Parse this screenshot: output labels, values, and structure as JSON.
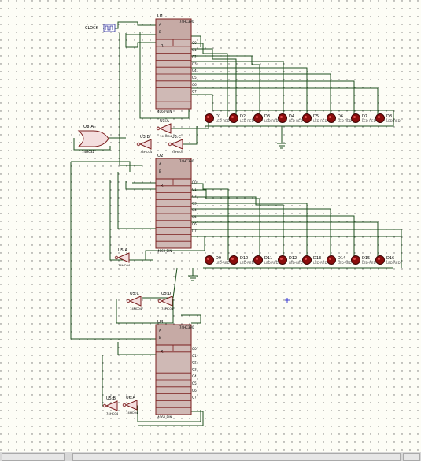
{
  "clock": {
    "label": "CLOCK"
  },
  "counters": [
    {
      "ref": "U1",
      "part": "74HC390"
    },
    {
      "ref": "U2",
      "part": "74HC390"
    },
    {
      "ref": "U4",
      "part": "74HC390"
    }
  ],
  "counter_pins": {
    "left_a": "A",
    "left_b": "B",
    "left_clk": "CLK",
    "reset": "R",
    "q0": "Q0",
    "q1": "Q1",
    "q2": "Q2",
    "q3": "Q3",
    "q4": "Q4",
    "q5": "Q5",
    "q6": "Q6",
    "q7": "Q7"
  },
  "chip_footer": "4060 BIN",
  "gates": [
    {
      "ref": "U3:A",
      "sub": "74HC04"
    },
    {
      "ref": "U3:B",
      "sub": "74HC04"
    },
    {
      "ref": "U3:C",
      "sub": "74HC04"
    },
    {
      "ref": "U5:A",
      "sub": "74HC04"
    },
    {
      "ref": "U5:B",
      "sub": "74HC04"
    },
    {
      "ref": "U5:C",
      "sub": "74HC04"
    },
    {
      "ref": "U5:D",
      "sub": "74HC04"
    },
    {
      "ref": "U6:A",
      "sub": "74HC04"
    }
  ],
  "or_gate": {
    "ref": "U8:A",
    "sub": "74HC32"
  },
  "leds_row1": [
    "D1",
    "D2",
    "D3",
    "D4",
    "D5",
    "D6",
    "D7",
    "D8"
  ],
  "leds_row2": [
    "D9",
    "D10",
    "D11",
    "D12",
    "D13",
    "D14",
    "D15",
    "D16"
  ],
  "led_sub": "LED-RED"
}
